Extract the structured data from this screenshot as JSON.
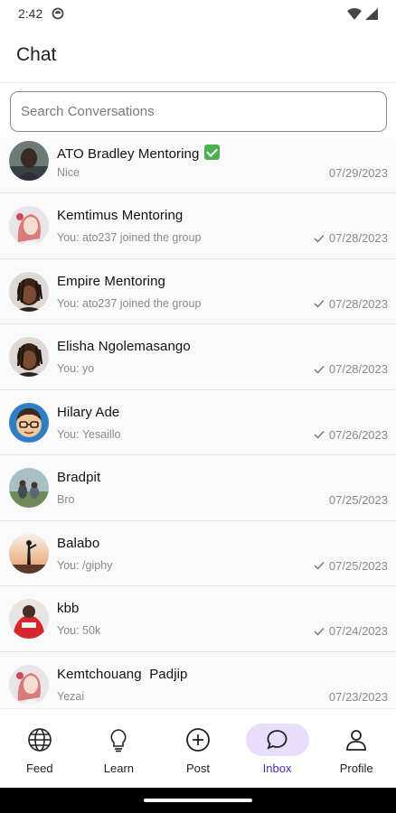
{
  "status_bar": {
    "time": "2:42"
  },
  "header": {
    "title": "Chat"
  },
  "search": {
    "placeholder": "Search Conversations"
  },
  "conversations": [
    {
      "name": "ATO Bradley Mentoring",
      "verified": true,
      "message": "Nice",
      "date": "07/29/2023",
      "read_check": false,
      "avatar": "dark-portrait"
    },
    {
      "name": "Kemtimus Mentoring",
      "verified": false,
      "message": "You: ato237 joined the group",
      "date": "07/28/2023",
      "read_check": true,
      "avatar": "anime-girl"
    },
    {
      "name": "Empire Mentoring",
      "verified": false,
      "message": "You: ato237 joined the group",
      "date": "07/28/2023",
      "read_check": true,
      "avatar": "dreadlocks-portrait"
    },
    {
      "name": "Elisha Ngolemasango",
      "verified": false,
      "message": "You: yo",
      "date": "07/28/2023",
      "read_check": true,
      "avatar": "dreadlocks-portrait"
    },
    {
      "name": "Hilary Ade",
      "verified": false,
      "message": "You: Yesaillo",
      "date": "07/26/2023",
      "read_check": true,
      "avatar": "cartoon-glasses"
    },
    {
      "name": "Bradpit",
      "verified": false,
      "message": "Bro",
      "date": "07/25/2023",
      "read_check": false,
      "avatar": "outdoor-group"
    },
    {
      "name": "Balabo",
      "verified": false,
      "message": "You: /giphy",
      "date": "07/25/2023",
      "read_check": true,
      "avatar": "sunset-silhouette"
    },
    {
      "name": "kbb",
      "verified": false,
      "message": "You: 50k",
      "date": "07/24/2023",
      "read_check": true,
      "avatar": "red-shirt"
    },
    {
      "name": "Kemtchouang  Padjip",
      "verified": false,
      "message": "Yezai",
      "date": "07/23/2023",
      "read_check": false,
      "avatar": "anime-girl"
    }
  ],
  "nav": {
    "items": [
      {
        "label": "Feed",
        "icon": "globe-icon",
        "active": false
      },
      {
        "label": "Learn",
        "icon": "lightbulb-icon",
        "active": false
      },
      {
        "label": "Post",
        "icon": "plus-circle-icon",
        "active": false
      },
      {
        "label": "Inbox",
        "icon": "chat-bubble-icon",
        "active": true
      },
      {
        "label": "Profile",
        "icon": "person-icon",
        "active": false
      }
    ]
  },
  "colors": {
    "accent": "#4b2fb3",
    "active_pill": "#e8defc",
    "verified": "#4cb050"
  }
}
